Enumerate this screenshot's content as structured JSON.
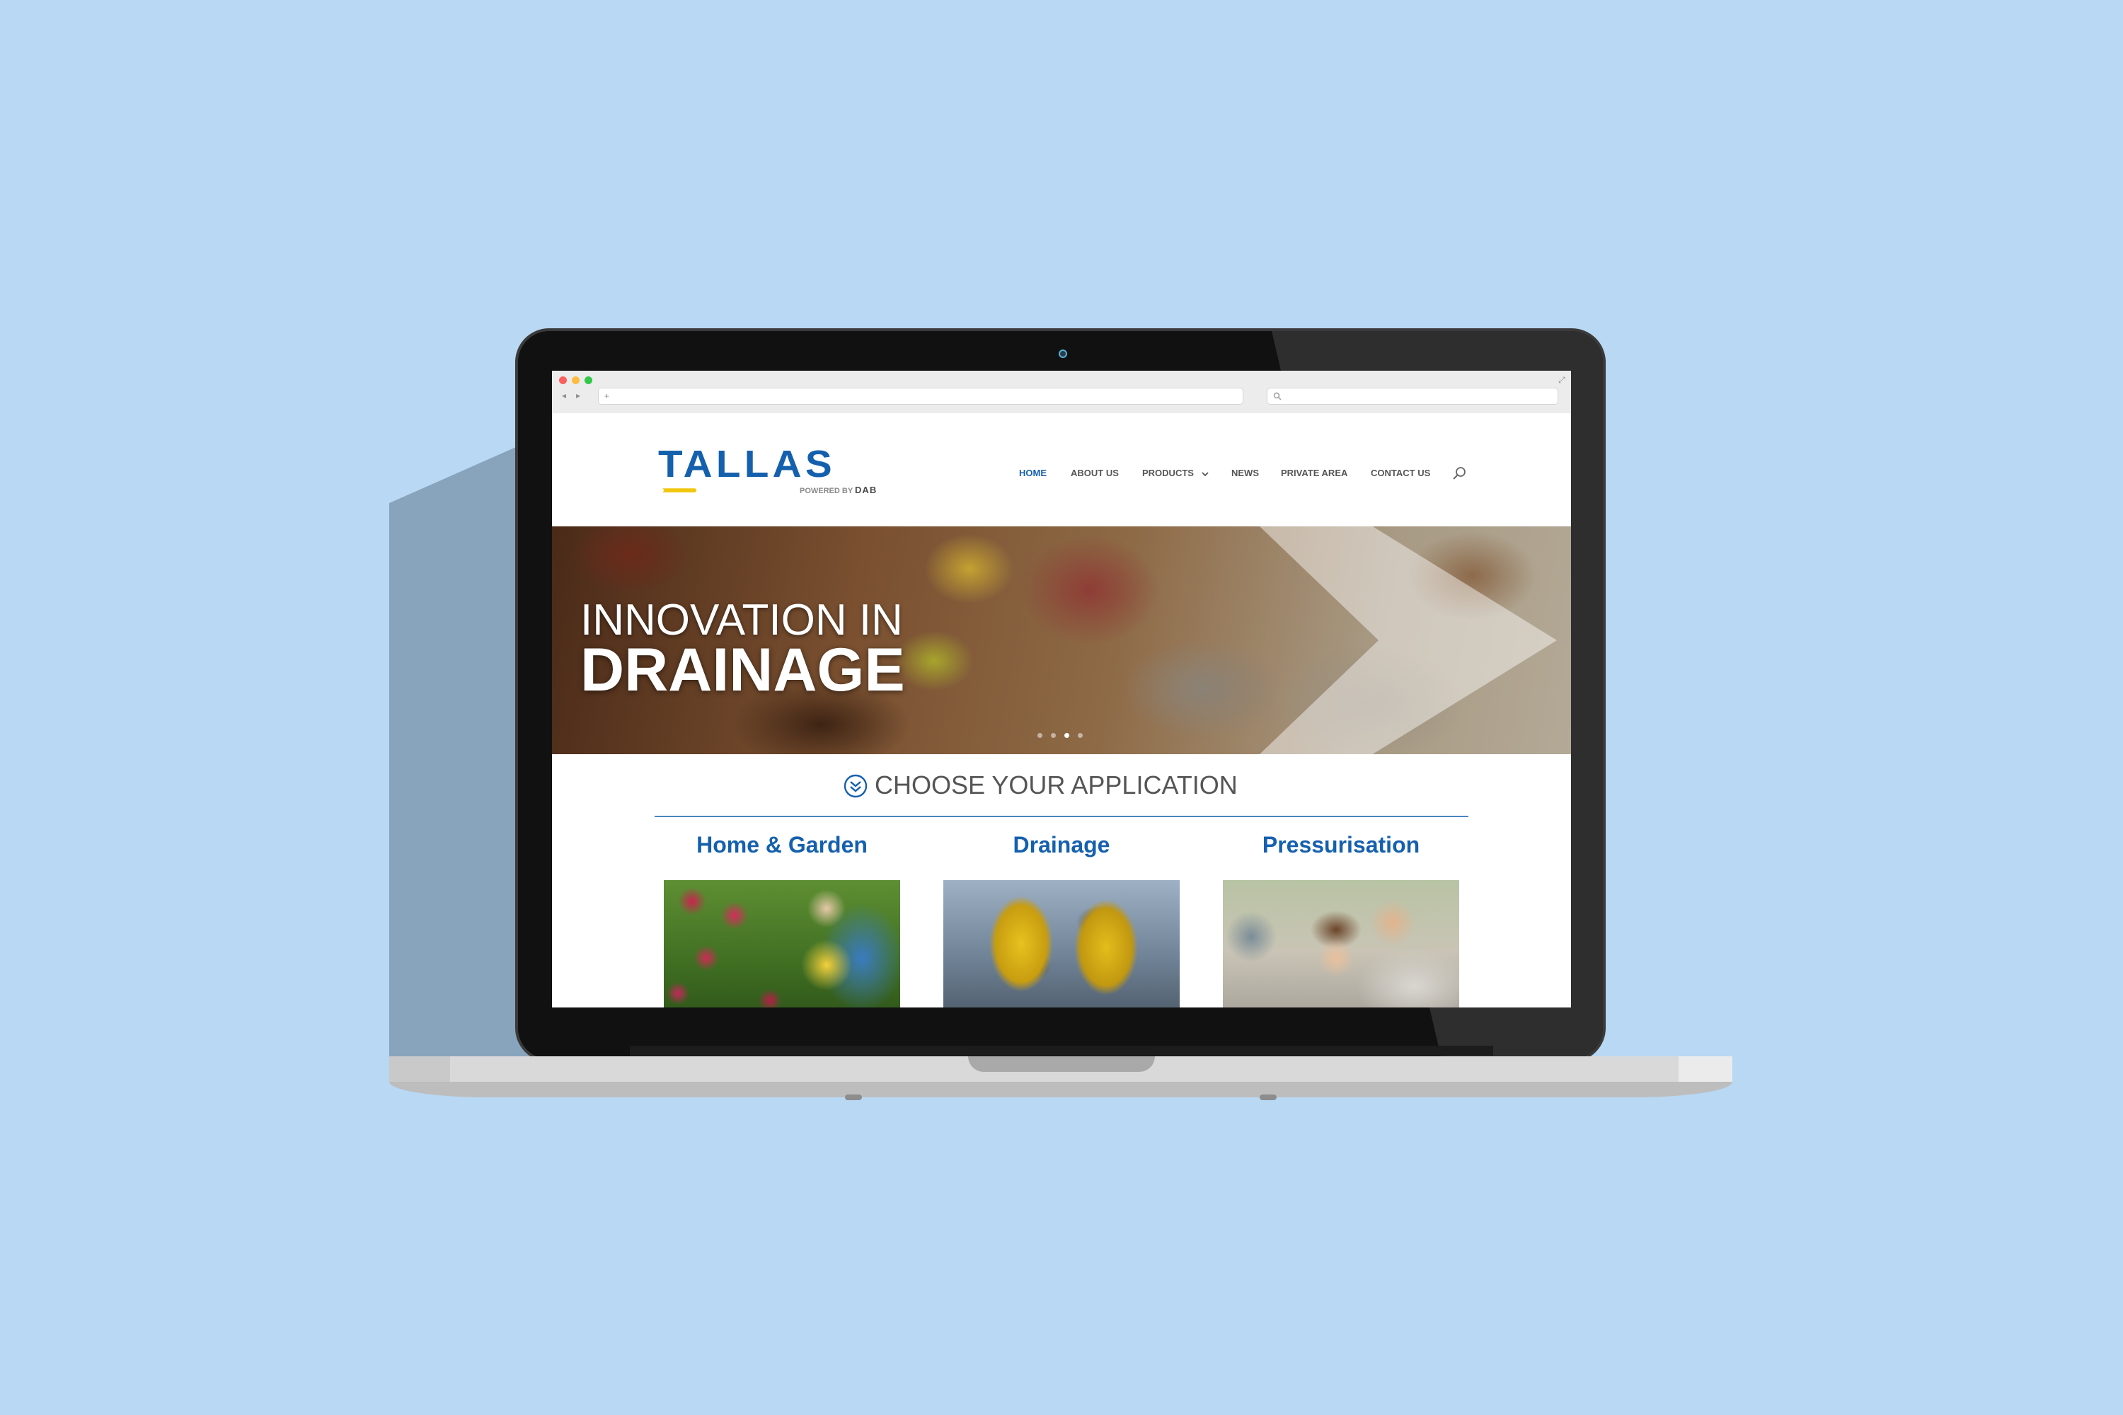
{
  "site": {
    "logo": {
      "name": "TALLAS",
      "chevrons": "›››››››››››››››››››››››",
      "powered_by": "POWERED BY",
      "brand": "DAB"
    },
    "nav": [
      {
        "label": "HOME",
        "active": true
      },
      {
        "label": "ABOUT US",
        "active": false
      },
      {
        "label": "PRODUCTS",
        "active": false,
        "has_dropdown": true,
        "dropdown_icon": "chevron-down-icon"
      },
      {
        "label": "NEWS",
        "active": false
      },
      {
        "label": "PRIVATE AREA",
        "active": false
      },
      {
        "label": "CONTACT US",
        "active": false
      }
    ],
    "search_icon": "search-icon"
  },
  "hero": {
    "line1": "INNOVATION IN",
    "line2": "DRAINAGE",
    "slides_count": 4,
    "active_slide": 3
  },
  "applications": {
    "heading": "CHOOSE YOUR APPLICATION",
    "heading_icon": "double-chevron-down-circle-icon",
    "items": [
      {
        "title": "Home & Garden"
      },
      {
        "title": "Drainage"
      },
      {
        "title": "Pressurisation"
      }
    ]
  },
  "colors": {
    "brand_blue": "#1560ad",
    "accent_yellow": "#f0c400",
    "background": "#b8d8f3"
  }
}
